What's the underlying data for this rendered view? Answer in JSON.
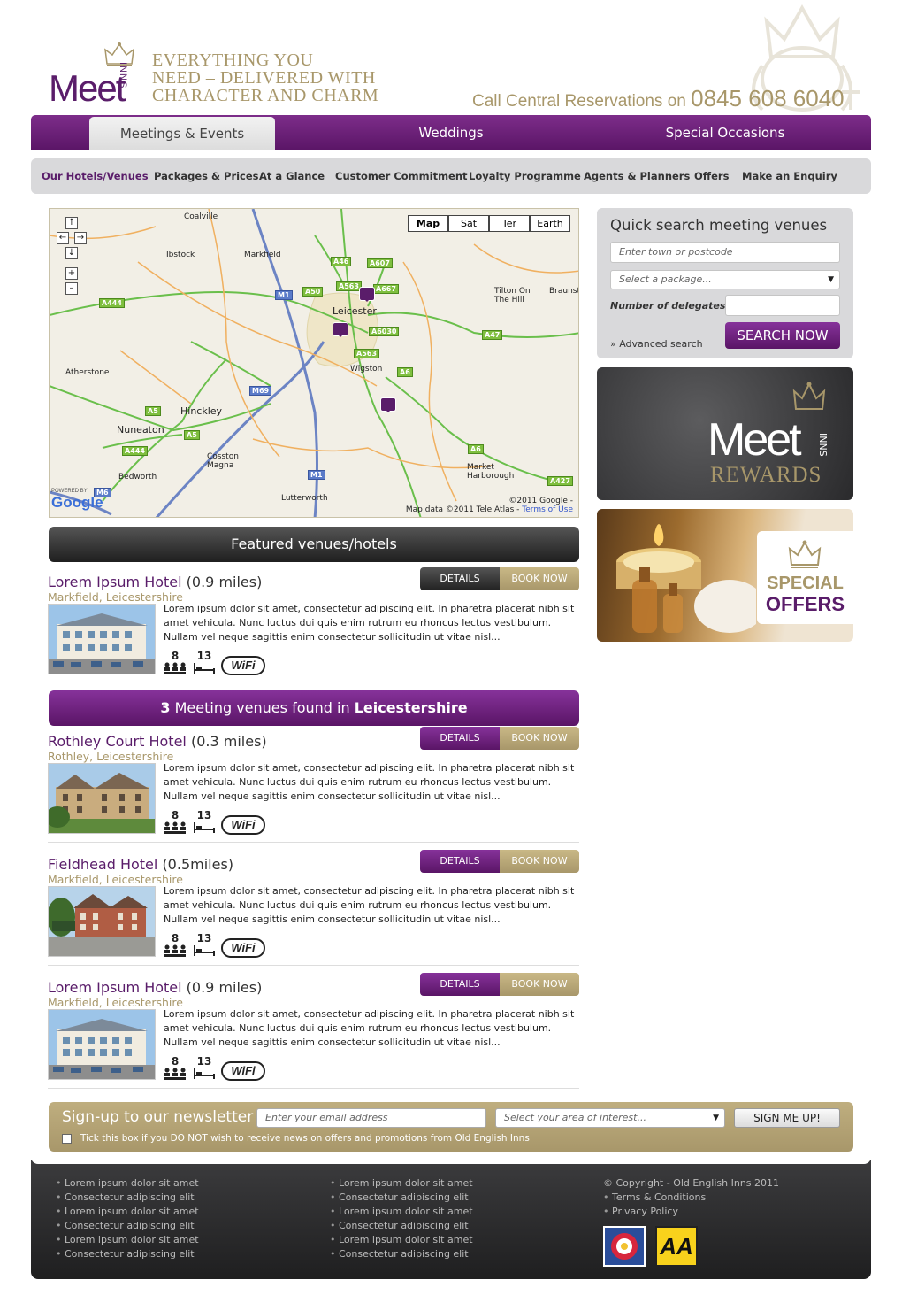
{
  "header": {
    "logo_word": "Meet",
    "logo_inns": "INNS",
    "tagline": [
      "EVERYTHING YOU",
      "NEED – DELIVERED WITH",
      "CHARACTER AND CHARM"
    ],
    "reservations_label": "Call Central Reservations on",
    "reservations_phone": "0845 608 6040"
  },
  "main_nav": {
    "tabs": [
      {
        "label": "Meetings & Events",
        "active": true
      },
      {
        "label": "Weddings",
        "active": false
      },
      {
        "label": "Special Occasions",
        "active": false
      }
    ]
  },
  "sub_nav": {
    "items": [
      {
        "label": "Our Hotels/Venues",
        "active": true
      },
      {
        "label": "Packages & Prices"
      },
      {
        "label": "At a Glance"
      },
      {
        "label": "Customer Commitment"
      },
      {
        "label": "Loyalty Programme"
      },
      {
        "label": "Agents & Planners"
      },
      {
        "label": "Offers"
      },
      {
        "label": "Make an Enquiry"
      }
    ]
  },
  "map": {
    "types": [
      "Map",
      "Sat",
      "Ter",
      "Earth"
    ],
    "active_type": "Map",
    "places": [
      "Coalville",
      "Ibstock",
      "Markfield",
      "Leicester",
      "Tilton On The Hill",
      "Braunst",
      "Atherstone",
      "Hinckley",
      "Wigston",
      "Nuneaton",
      "Cosston Magna",
      "Bedworth",
      "Lutterworth",
      "Market Harborough"
    ],
    "roads": [
      "A46",
      "A607",
      "A563",
      "A50",
      "M1",
      "A444",
      "A6030",
      "A47",
      "A563",
      "A6",
      "M69",
      "A5",
      "A5",
      "A444",
      "M1",
      "A6",
      "A427",
      "M6",
      "A667"
    ],
    "copyright": "©2011 Google -",
    "map_data": "Map data ©2011 Tele Atlas -",
    "terms_link": "Terms of Use",
    "google_logo": "Google",
    "powered_by": "POWERED BY"
  },
  "featured": {
    "heading": "Featured venues/hotels",
    "venue": {
      "name": "Lorem Ipsum Hotel",
      "distance": "(0.9 miles)",
      "location": "Markfield, Leicestershire",
      "description": "Lorem ipsum dolor sit amet, consectetur adipiscing elit. In pharetra placerat nibh sit amet vehicula. Nunc luctus dui quis enim rutrum eu rhoncus lectus vestibulum. Nullam vel neque sagittis enim consectetur sollicitudin ut vitae nisl...",
      "capacity": "8",
      "rooms": "13",
      "wifi": "WiFi"
    }
  },
  "results": {
    "count": "3",
    "heading_mid": "Meeting venues found in",
    "region": "Leicestershire",
    "venues": [
      {
        "name": "Rothley Court Hotel",
        "distance": "(0.3 miles)",
        "location": "Rothley, Leicestershire",
        "description": "Lorem ipsum dolor sit amet, consectetur adipiscing elit. In pharetra placerat nibh sit amet vehicula. Nunc luctus dui quis enim rutrum eu rhoncus lectus vestibulum. Nullam vel neque sagittis enim consectetur sollicitudin ut vitae nisl...",
        "capacity": "8",
        "rooms": "13",
        "wifi": "WiFi"
      },
      {
        "name": "Fieldhead Hotel",
        "distance": "(0.5miles)",
        "location": "Markfield, Leicestershire",
        "description": "Lorem ipsum dolor sit amet, consectetur adipiscing elit. In pharetra placerat nibh sit amet vehicula. Nunc luctus dui quis enim rutrum eu rhoncus lectus vestibulum. Nullam vel neque sagittis enim consectetur sollicitudin ut vitae nisl...",
        "capacity": "8",
        "rooms": "13",
        "wifi": "WiFi"
      },
      {
        "name": "Lorem Ipsum Hotel",
        "distance": "(0.9 miles)",
        "location": "Markfield, Leicestershire",
        "description": "Lorem ipsum dolor sit amet, consectetur adipiscing elit. In pharetra placerat nibh sit amet vehicula. Nunc luctus dui quis enim rutrum eu rhoncus lectus vestibulum. Nullam vel neque sagittis enim consectetur sollicitudin ut vitae nisl...",
        "capacity": "8",
        "rooms": "13",
        "wifi": "WiFi"
      }
    ]
  },
  "buttons": {
    "details": "DETAILS",
    "book": "BOOK NOW"
  },
  "quick_search": {
    "title": "Quick search meeting venues",
    "town_placeholder": "Enter town or postcode",
    "package_placeholder": "Select a package...",
    "delegates_label": "Number of delegates:",
    "advanced": "» Advanced search",
    "submit": "SEARCH NOW"
  },
  "rewards": {
    "meet": "Meet",
    "inns": "INNS",
    "word": "REWARDS"
  },
  "offers": {
    "line1": "SPECIAL",
    "line2": "OFFERS"
  },
  "newsletter": {
    "title": "Sign-up to our newsletter",
    "email_placeholder": "Enter your email address",
    "area_placeholder": "Select your area of interest...",
    "submit": "SIGN ME UP!",
    "optout": "Tick this box if you DO NOT wish to receive news on offers and promotions from Old English Inns"
  },
  "footer": {
    "col1": [
      "Lorem ipsum dolor sit amet",
      "Consectetur adipiscing elit",
      "Lorem ipsum dolor sit amet",
      "Consectetur adipiscing elit",
      "Lorem ipsum dolor sit amet",
      "Consectetur adipiscing elit"
    ],
    "col2": [
      "Lorem ipsum dolor sit amet",
      "Consectetur adipiscing elit",
      "Lorem ipsum dolor sit amet",
      "Consectetur adipiscing elit",
      "Lorem ipsum dolor sit amet",
      "Consectetur adipiscing elit"
    ],
    "copyright": "© Copyright - Old English Inns 2011",
    "terms": "Terms & Conditions",
    "privacy": "Privacy Policy",
    "badge_aa": "AA"
  },
  "colors": {
    "purple": "#5a1d6a",
    "gold": "#a8976a",
    "grey_nav": "#d9d9db",
    "dark": "#222222"
  },
  "icons": [
    "crown-icon",
    "crest-icon",
    "people-icon",
    "bed-icon",
    "wifi-icon",
    "map-pin-icon",
    "dropdown-arrow-icon",
    "tudor-rose-icon"
  ]
}
